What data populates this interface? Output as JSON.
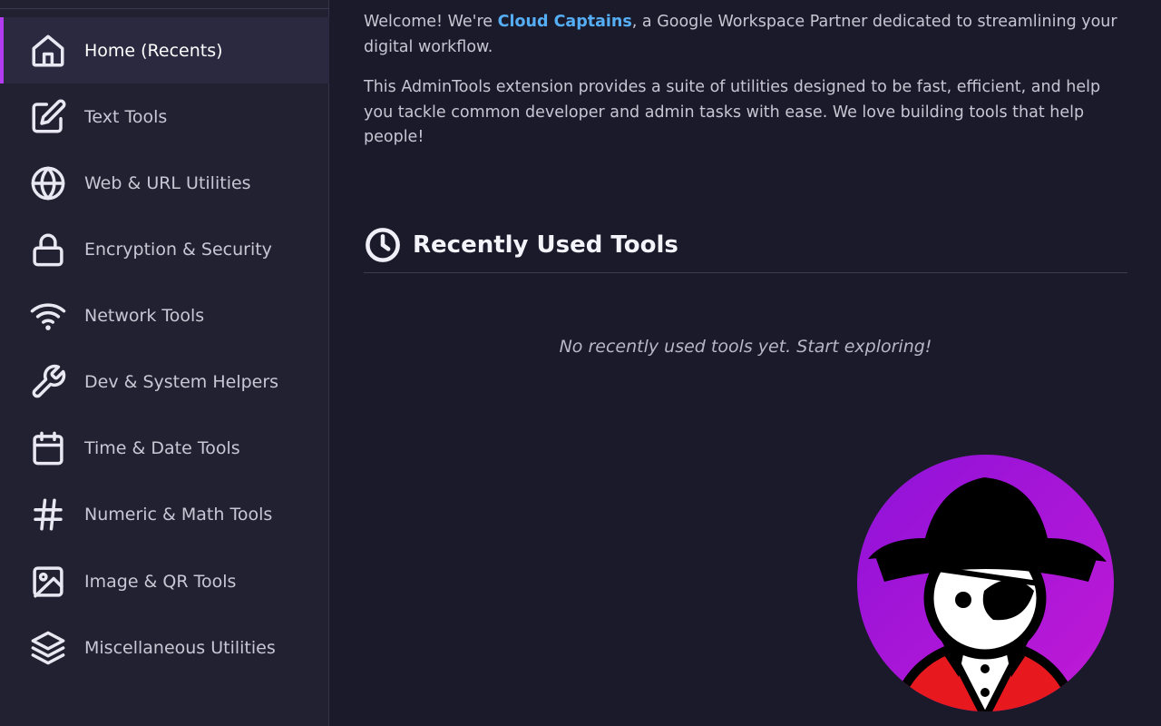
{
  "sidebar": {
    "items": [
      {
        "label": "Home (Recents)",
        "icon": "home-icon",
        "active": true
      },
      {
        "label": "Text Tools",
        "icon": "edit-icon"
      },
      {
        "label": "Web & URL Utilities",
        "icon": "globe-icon"
      },
      {
        "label": "Encryption & Security",
        "icon": "lock-icon"
      },
      {
        "label": "Network Tools",
        "icon": "wifi-icon"
      },
      {
        "label": "Dev & System Helpers",
        "icon": "wrench-icon"
      },
      {
        "label": "Time & Date Tools",
        "icon": "calendar-icon"
      },
      {
        "label": "Numeric & Math Tools",
        "icon": "hash-icon"
      },
      {
        "label": "Image & QR Tools",
        "icon": "image-icon"
      },
      {
        "label": "Miscellaneous Utilities",
        "icon": "layers-icon"
      }
    ]
  },
  "main": {
    "intro_prefix": "Welcome! We're ",
    "brand_name": "Cloud Captains",
    "intro_suffix": ", a Google Workspace Partner dedicated to streamlining your digital workflow.",
    "description": "This AdminTools extension provides a suite of utilities designed to be fast, efficient, and help you tackle common developer and admin tasks with ease. We love building tools that help people!",
    "recent_title": "Recently Used Tools",
    "empty_message": "No recently used tools yet. Start exploring!"
  },
  "colors": {
    "accent": "#b43cf0",
    "brand_link": "#55aef5",
    "background": "#1b1a2a",
    "sidebar": "#222131"
  }
}
